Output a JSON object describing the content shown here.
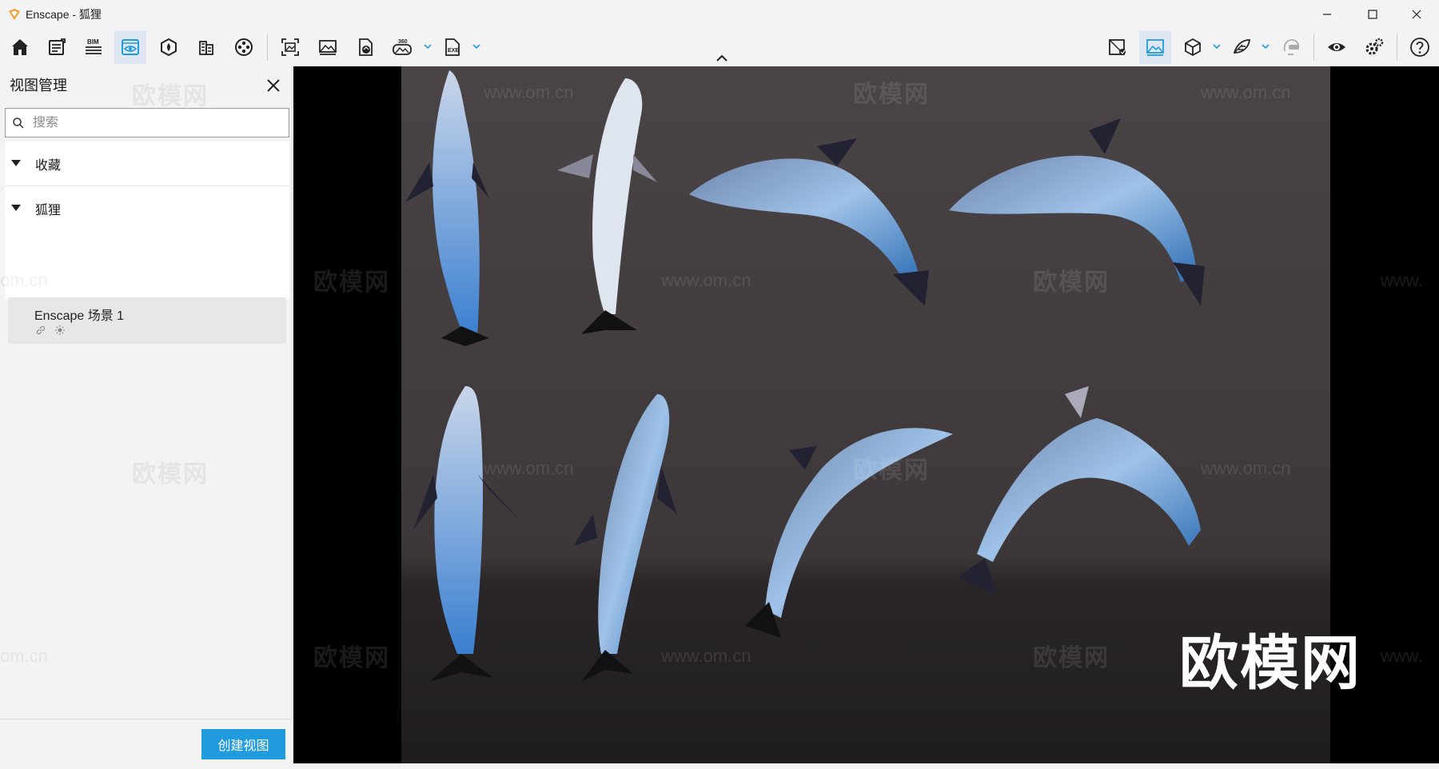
{
  "window": {
    "title": "Enscape - 狐狸",
    "controls": [
      "minimize-icon",
      "maximize-icon",
      "close-icon"
    ]
  },
  "toolbar": {
    "left_buttons": [
      {
        "name": "home-icon",
        "active": false
      },
      {
        "name": "asset-library-icon",
        "active": false
      },
      {
        "name": "bim-icon",
        "label": "BIM",
        "active": false
      },
      {
        "name": "views-icon",
        "active": true
      },
      {
        "name": "material-icon",
        "active": false
      },
      {
        "name": "site-context-icon",
        "active": false
      },
      {
        "name": "video-editor-icon",
        "active": false
      },
      {
        "name": "screenshot-icon",
        "active": false
      },
      {
        "name": "batch-render-icon",
        "active": false
      },
      {
        "name": "web-standalone-icon",
        "active": false
      },
      {
        "name": "panorama-360-icon",
        "label": "360",
        "active": false
      },
      {
        "name": "export-exe-icon",
        "label": "EXE",
        "active": false
      }
    ],
    "right_buttons": [
      {
        "name": "sync-views-icon",
        "active": false
      },
      {
        "name": "capture-icon",
        "active": true
      },
      {
        "name": "cube-view-icon",
        "active": false
      },
      {
        "name": "collaborative-annotation-icon",
        "active": false
      },
      {
        "name": "vr-headset-icon",
        "active": false
      },
      {
        "name": "visual-settings-icon",
        "active": false
      },
      {
        "name": "general-settings-icon",
        "active": false
      },
      {
        "name": "help-icon",
        "active": false
      }
    ]
  },
  "panel": {
    "title": "视图管理",
    "search_placeholder": "搜索",
    "favorites_label": "收藏",
    "group_label": "狐狸",
    "views": [
      {
        "name": "Enscape 场景 1",
        "icons": [
          "link-icon",
          "sun-icon"
        ]
      }
    ],
    "create_button": "创建视图"
  },
  "viewport": {
    "watermark_text": "欧模网",
    "watermark_url": "www.om.cn",
    "big_watermark": "欧模网",
    "left_cut_url": "om.cn",
    "right_cut_url": "www.",
    "subject": "dolphins"
  },
  "colors": {
    "accent": "#1f9bde",
    "active_tab_bg": "#dfe8f2",
    "panel_bg": "#f3f3f3",
    "scene_bg": "#443e41"
  }
}
